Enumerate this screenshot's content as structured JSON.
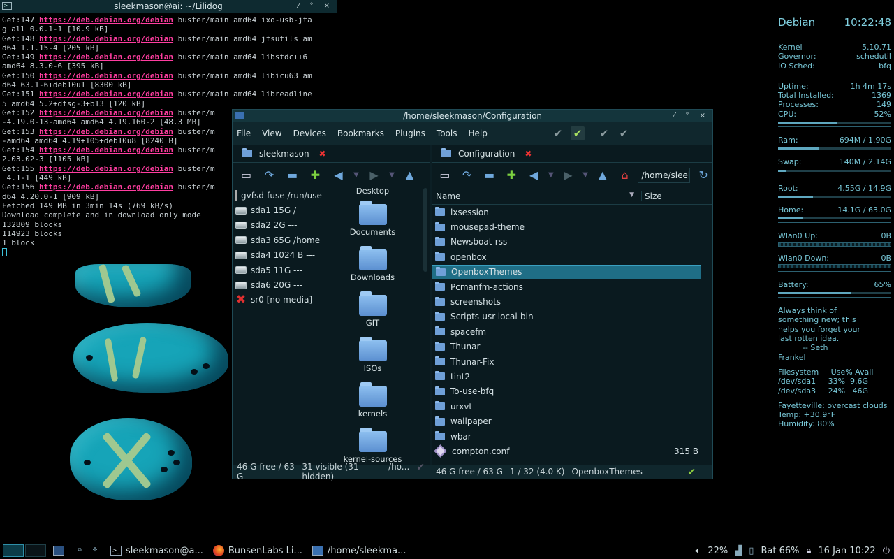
{
  "terminal": {
    "title": "sleekmason@ai: ~/Lilidog",
    "lines": [
      {
        "pre": "Get:147 ",
        "url": "https://deb.debian.org/debian",
        "post": " buster/main amd64 ixo-usb-jta"
      },
      {
        "pre": "g all 0.0.1-1 [10.9 kB]",
        "url": "",
        "post": ""
      },
      {
        "pre": "Get:148 ",
        "url": "https://deb.debian.org/debian",
        "post": " buster/main amd64 jfsutils am"
      },
      {
        "pre": "d64 1.1.15-4 [205 kB]",
        "url": "",
        "post": ""
      },
      {
        "pre": "Get:149 ",
        "url": "https://deb.debian.org/debian",
        "post": " buster/main amd64 libstdc++6"
      },
      {
        "pre": "amd64 8.3.0-6 [395 kB]",
        "url": "",
        "post": ""
      },
      {
        "pre": "Get:150 ",
        "url": "https://deb.debian.org/debian",
        "post": " buster/main amd64 libicu63 am"
      },
      {
        "pre": "d64 63.1-6+deb10u1 [8300 kB]",
        "url": "",
        "post": ""
      },
      {
        "pre": "Get:151 ",
        "url": "https://deb.debian.org/debian",
        "post": " buster/main amd64 libreadline"
      },
      {
        "pre": "5 amd64 5.2+dfsg-3+b13 [120 kB]",
        "url": "",
        "post": ""
      },
      {
        "pre": "Get:152 ",
        "url": "https://deb.debian.org/debian",
        "post": " buster/m"
      },
      {
        "pre": "-4.19.0-13-amd64 amd64 4.19.160-2 [48.3 MB]",
        "url": "",
        "post": ""
      },
      {
        "pre": "Get:153 ",
        "url": "https://deb.debian.org/debian",
        "post": " buster/m"
      },
      {
        "pre": "-amd64 amd64 4.19+105+deb10u8 [8240 B]",
        "url": "",
        "post": ""
      },
      {
        "pre": "Get:154 ",
        "url": "https://deb.debian.org/debian",
        "post": " buster/m"
      },
      {
        "pre": "2.03.02-3 [1105 kB]",
        "url": "",
        "post": ""
      },
      {
        "pre": "Get:155 ",
        "url": "https://deb.debian.org/debian",
        "post": " buster/m"
      },
      {
        "pre": " 4.1-1 [449 kB]",
        "url": "",
        "post": ""
      },
      {
        "pre": "Get:156 ",
        "url": "https://deb.debian.org/debian",
        "post": " buster/m"
      },
      {
        "pre": "d64 4.20.0-1 [909 kB]",
        "url": "",
        "post": ""
      },
      {
        "pre": "Fetched 149 MB in 3min 14s (769 kB/s)",
        "url": "",
        "post": ""
      },
      {
        "pre": "Download complete and in download only mode",
        "url": "",
        "post": ""
      },
      {
        "pre": "132809 blocks",
        "url": "",
        "post": ""
      },
      {
        "pre": "114923 blocks",
        "url": "",
        "post": ""
      },
      {
        "pre": "1 block",
        "url": "",
        "post": ""
      }
    ]
  },
  "fm": {
    "title": "/home/sleekmason/Configuration",
    "menu": [
      "File",
      "View",
      "Devices",
      "Bookmarks",
      "Plugins",
      "Tools",
      "Help"
    ],
    "left_tab": "sleekmason",
    "right_tab": "Configuration",
    "right_path": "/home/sleekm",
    "devices": [
      {
        "icon": "doc",
        "label": "gvfsd-fuse /run/user"
      },
      {
        "icon": "hd",
        "label": "sda1 15G /"
      },
      {
        "icon": "hd",
        "label": "sda2 2G ---"
      },
      {
        "icon": "hd",
        "label": "sda3 65G /home"
      },
      {
        "icon": "hd",
        "label": "sda4 1024 B ---"
      },
      {
        "icon": "hd",
        "label": "sda5 11G ---"
      },
      {
        "icon": "hd",
        "label": "sda6 20G ---"
      },
      {
        "icon": "x",
        "label": "sr0 [no media]"
      }
    ],
    "icon_top_label": "Desktop",
    "icons": [
      "Documents",
      "Downloads",
      "GIT",
      "ISOs",
      "kernels",
      "kernel-sources"
    ],
    "col_name": "Name",
    "col_size": "Size",
    "files": [
      {
        "name": "lxsession",
        "size": "",
        "type": "folder"
      },
      {
        "name": "mousepad-theme",
        "size": "",
        "type": "folder"
      },
      {
        "name": "Newsboat-rss",
        "size": "",
        "type": "folder"
      },
      {
        "name": "openbox",
        "size": "",
        "type": "folder"
      },
      {
        "name": "OpenboxThemes",
        "size": "",
        "type": "folder",
        "selected": true
      },
      {
        "name": "Pcmanfm-actions",
        "size": "",
        "type": "folder"
      },
      {
        "name": "screenshots",
        "size": "",
        "type": "folder"
      },
      {
        "name": "Scripts-usr-local-bin",
        "size": "",
        "type": "folder"
      },
      {
        "name": "spacefm",
        "size": "",
        "type": "folder"
      },
      {
        "name": "Thunar",
        "size": "",
        "type": "folder"
      },
      {
        "name": "Thunar-Fix",
        "size": "",
        "type": "folder"
      },
      {
        "name": "tint2",
        "size": "",
        "type": "folder"
      },
      {
        "name": "To-use-bfq",
        "size": "",
        "type": "folder"
      },
      {
        "name": "urxvt",
        "size": "",
        "type": "folder"
      },
      {
        "name": "wallpaper",
        "size": "",
        "type": "folder"
      },
      {
        "name": "wbar",
        "size": "",
        "type": "folder"
      },
      {
        "name": "compton.conf",
        "size": "315 B",
        "type": "conf"
      }
    ],
    "status_left": [
      "46 G free / 63 G",
      "31 visible (31 hidden)",
      "/ho..."
    ],
    "status_right": [
      "46 G free / 63 G",
      "1 / 32 (4.0 K)",
      "OpenboxThemes"
    ]
  },
  "conky": {
    "os": "Debian",
    "time": "10:22:48",
    "kernel": [
      "Kernel",
      "5.10.71"
    ],
    "governor": [
      "Governor:",
      "schedutil"
    ],
    "iosched": [
      "IO Sched:",
      "bfq"
    ],
    "uptime": [
      "Uptime:",
      "1h 4m 17s"
    ],
    "installed": [
      "Total Installed:",
      "1369"
    ],
    "processes": [
      "Processes:",
      "149"
    ],
    "cpu": [
      "CPU:",
      "52%"
    ],
    "cpu_frac": 0.52,
    "ram": [
      "Ram:",
      "694M  / 1.90G"
    ],
    "ram_frac": 0.36,
    "swap": [
      "Swap:",
      "140M  / 2.14G"
    ],
    "swap_frac": 0.07,
    "root": [
      "Root:",
      "4.55G / 14.9G"
    ],
    "root_frac": 0.31,
    "home": [
      "Home:",
      "14.1G / 63.0G"
    ],
    "home_frac": 0.22,
    "wlan_up": [
      "Wlan0 Up:",
      "0B"
    ],
    "wlan_down": [
      "Wlan0 Down:",
      "0B"
    ],
    "battery": [
      "Battery:",
      "65%"
    ],
    "battery_frac": 0.65,
    "quote": [
      "Always think of",
      "something new; this",
      "helps you forget your",
      "last rotten idea.",
      "          -- Seth",
      "Frankel"
    ],
    "fs_header": "Filesystem     Use% Avail",
    "fs_rows": [
      "/dev/sda1     33%  9.6G",
      "/dev/sda3     24%   46G"
    ],
    "weather": [
      "Fayetteville: overcast clouds",
      "Temp: +30.9°F",
      "Humidity: 80%"
    ]
  },
  "taskbar": {
    "tasks": [
      "sleekmason@a...",
      "BunsenLabs Li...",
      "/home/sleekma..."
    ],
    "volume": "22%",
    "battery": "Bat 66%",
    "clock": "16 Jan 10:22"
  }
}
